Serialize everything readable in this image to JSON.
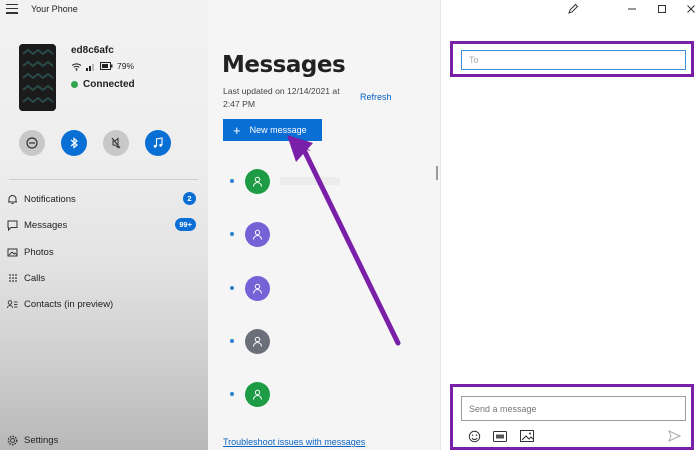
{
  "app": {
    "title": "Your Phone"
  },
  "device": {
    "name": "ed8c6afc",
    "battery": "79%",
    "status": "Connected"
  },
  "quick_actions": [
    {
      "icon": "do-not-disturb-icon",
      "state": "off"
    },
    {
      "icon": "bluetooth-icon",
      "state": "on"
    },
    {
      "icon": "mute-icon",
      "state": "off"
    },
    {
      "icon": "music-icon",
      "state": "on"
    }
  ],
  "nav": {
    "notifications": {
      "label": "Notifications",
      "badge": "2"
    },
    "messages": {
      "label": "Messages",
      "badge": "99+"
    },
    "photos": {
      "label": "Photos"
    },
    "calls": {
      "label": "Calls"
    },
    "contacts": {
      "label": "Contacts (in preview)"
    },
    "settings": {
      "label": "Settings"
    }
  },
  "messages": {
    "title": "Messages",
    "last_updated": "Last updated on 12/14/2021 at 2:47 PM",
    "refresh": "Refresh",
    "new_message": "New message",
    "troubleshoot": "Troubleshoot issues with messages",
    "conversations": [
      {
        "avatar_color": "#1e9b45"
      },
      {
        "avatar_color": "#7462d6"
      },
      {
        "avatar_color": "#7462d6"
      },
      {
        "avatar_color": "#6b6f7a"
      },
      {
        "avatar_color": "#1e9b45"
      }
    ]
  },
  "compose": {
    "to_placeholder": "To",
    "message_placeholder": "Send a message",
    "tools": [
      "emoji-icon",
      "gif-icon",
      "image-icon"
    ],
    "send_icon": "send-icon"
  },
  "colors": {
    "accent": "#0a6fd4",
    "highlight": "#7a1fa8",
    "connected": "#2ea44f"
  }
}
